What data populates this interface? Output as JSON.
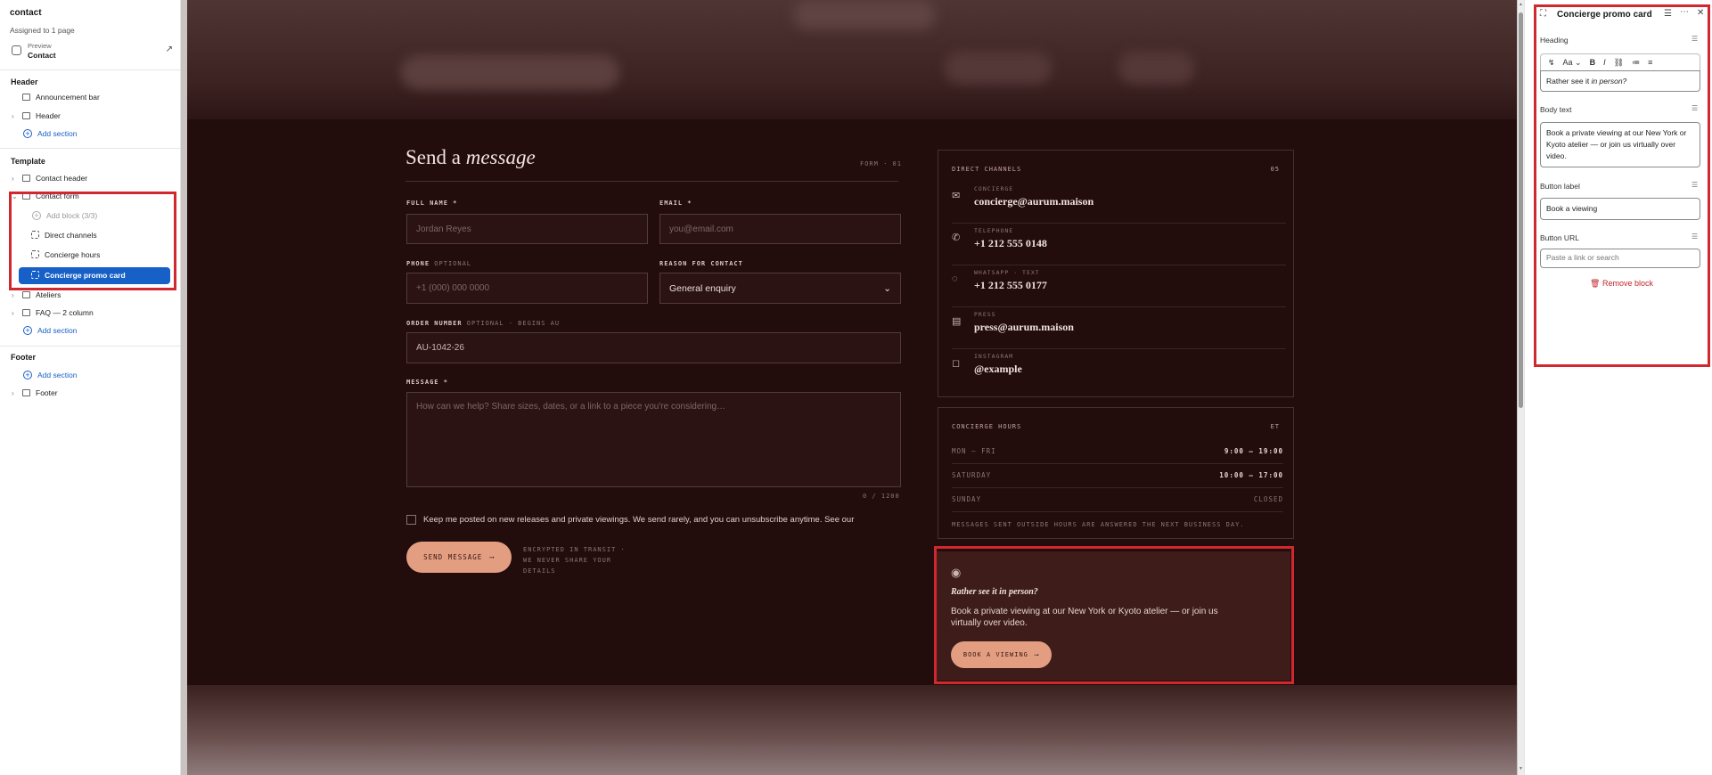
{
  "sidebar": {
    "title": "contact",
    "assigned": "Assigned to 1 page",
    "preview_label": "Preview",
    "preview_page": "Contact",
    "groups": {
      "header": "Header",
      "template": "Template",
      "footer": "Footer"
    },
    "items": {
      "announcement_bar": "Announcement bar",
      "header": "Header",
      "add_section_1": "Add section",
      "contact_header": "Contact header",
      "contact_form": "Contact form",
      "add_block": "Add block (3/3)",
      "direct_channels": "Direct channels",
      "concierge_hours": "Concierge hours",
      "concierge_promo": "Concierge promo card",
      "ateliers": "Ateliers",
      "faq": "FAQ — 2 column",
      "add_section_2": "Add section",
      "add_section_3": "Add section",
      "footer": "Footer"
    }
  },
  "form": {
    "heading_plain": "Send a",
    "heading_italic": "message",
    "tag": "FORM · 01",
    "full_name_label": "FULL NAME *",
    "full_name_placeholder": "Jordan Reyes",
    "email_label": "EMAIL *",
    "email_placeholder": "you@email.com",
    "phone_label": "PHONE",
    "phone_optional": "OPTIONAL",
    "phone_placeholder": "+1 (000) 000 0000",
    "reason_label": "REASON FOR CONTACT",
    "reason_value": "General enquiry",
    "order_label": "ORDER NUMBER",
    "order_optional": "OPTIONAL · BEGINS AU",
    "order_value": "AU-1042-26",
    "message_label": "MESSAGE *",
    "message_placeholder": "How can we help? Share sizes, dates, or a link to a piece you're considering…",
    "counter": "0 / 1200",
    "newsletter_text": "Keep me posted on new releases and private viewings. We send rarely, and you can unsubscribe anytime. See our",
    "send_label": "SEND MESSAGE",
    "encrypted_note": "ENCRYPTED IN TRANSIT · WE NEVER SHARE YOUR DETAILS"
  },
  "channels": {
    "title": "DIRECT CHANNELS",
    "number": "05",
    "items": [
      {
        "label": "CONCIERGE",
        "value": "concierge@aurum.maison",
        "icon": "mail-icon"
      },
      {
        "label": "TELEPHONE",
        "value": "+1 212 555 0148",
        "icon": "phone-icon"
      },
      {
        "label": "WHATSAPP · TEXT",
        "value": "+1 212 555 0177",
        "icon": "whatsapp-icon"
      },
      {
        "label": "PRESS",
        "value": "press@aurum.maison",
        "icon": "press-icon"
      },
      {
        "label": "INSTAGRAM",
        "value": "@example",
        "icon": "instagram-icon"
      }
    ]
  },
  "hours": {
    "title": "CONCIERGE HOURS",
    "tz": "ET",
    "rows": [
      {
        "day": "MON – FRI",
        "time": "9:00 – 19:00"
      },
      {
        "day": "SATURDAY",
        "time": "10:00 – 17:00"
      },
      {
        "day": "SUNDAY",
        "time": "CLOSED"
      }
    ],
    "note": "MESSAGES SENT OUTSIDE HOURS ARE ANSWERED THE NEXT BUSINESS DAY."
  },
  "promo": {
    "heading_plain": "Rather see it",
    "heading_italic": "in person?",
    "body": "Book a private viewing at our New York or Kyoto atelier — or join us virtually over video.",
    "button": "BOOK A VIEWING"
  },
  "panel": {
    "title": "Concierge promo card",
    "heading_label": "Heading",
    "heading_value_plain": "Rather see it",
    "heading_value_italic": "in person?",
    "body_label": "Body text",
    "body_value": "Book a private viewing at our New York or Kyoto atelier — or join us virtually over video.",
    "button_label_label": "Button label",
    "button_label_value": "Book a viewing",
    "button_url_label": "Button URL",
    "button_url_placeholder": "Paste a link or search",
    "remove": "Remove block"
  },
  "colors": {
    "accent": "#1660c7",
    "highlight": "#d0282e",
    "site_bg": "#220c0c",
    "cta": "#e39e82"
  }
}
